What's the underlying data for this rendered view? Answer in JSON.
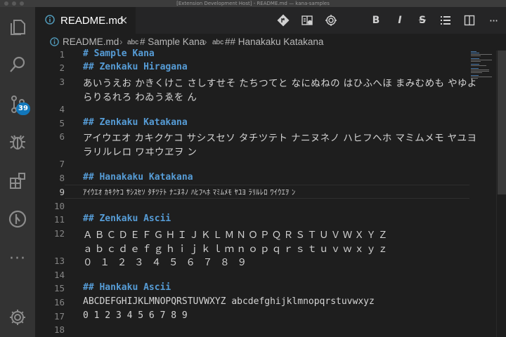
{
  "window": {
    "title": "[Extension Development Host] - README.md — kana-samples"
  },
  "activity_bar": {
    "scm_badge": "39"
  },
  "editor_tab": {
    "label": "README.md",
    "close_glyph": "×",
    "icon": "info-circle-icon"
  },
  "toolbar": {
    "actions": [
      "git-commit-icon",
      "open-preview-icon",
      "settings-icon",
      "bold-icon",
      "italic-icon",
      "strikethrough-icon",
      "list-icon",
      "split-editor-icon",
      "more-actions-icon"
    ],
    "bold_label": "B",
    "italic_label": "I",
    "strike_label": "S",
    "more_label": "···"
  },
  "breadcrumb": {
    "file": "README.md",
    "symbol1_kind": "abc",
    "symbol1": "# Sample Kana",
    "symbol2_kind": "abc",
    "symbol2": "## Hanakaku Katakana"
  },
  "editor": {
    "active_line": "9",
    "line_numbers": [
      "1",
      "2",
      "3",
      "4",
      "5",
      "6",
      "7",
      "8",
      "9",
      "10",
      "11",
      "12",
      "13",
      "14",
      "15",
      "16",
      "17",
      "18"
    ],
    "lines": [
      "# Sample Kana",
      "## Zenkaku Hiragana",
      "あいうえお かきくけこ さしすせそ たちつてと なにぬねの はひふへほ まみむめも やゆよ",
      "らりるれろ わゐうゑを ん",
      "## Zenkaku Katakana",
      "アイウエオ カキクケコ サシスセソ タチツテト ナニヌネノ ハヒフヘホ マミムメモ ヤユヨ",
      "ラリルレロ ワヰウヱヲ ン",
      "## Hanakaku Katakana",
      "ｱｲｳｴｵ ｶｷｸｹｺ ｻｼｽｾｿ ﾀﾁﾂﾃﾄ ﾅﾆﾇﾈﾉ ﾊﾋﾌﾍﾎ ﾏﾐﾑﾒﾓ ﾔﾕﾖ ﾗﾘﾙﾚﾛ ﾜｲｳｴｦ ﾝ",
      "## Zenkaku Ascii",
      "ＡＢＣＤＥＦＧＨＩＪＫＬＭＮＯＰＱＲＳＴＵＶＷＸＹＺ",
      "ａｂｃｄｅｆｇｈｉｊｋｌｍｎｏｐｑｒｓｔｕｖｗｘｙｚ",
      "０ １ ２ ３ ４ ５ ６ ７ ８ ９",
      "## Hankaku Ascii",
      "ABCDEFGHIJKLMNOPQRSTUVWXYZ abcdefghijklmnopqrstuvwxyz",
      "0 1 2 3 4 5 6 7 8 9"
    ]
  },
  "colors": {
    "heading": "#569cd6",
    "background": "#1e1e1e",
    "activity_bar": "#333333",
    "badge": "#1177bb"
  }
}
